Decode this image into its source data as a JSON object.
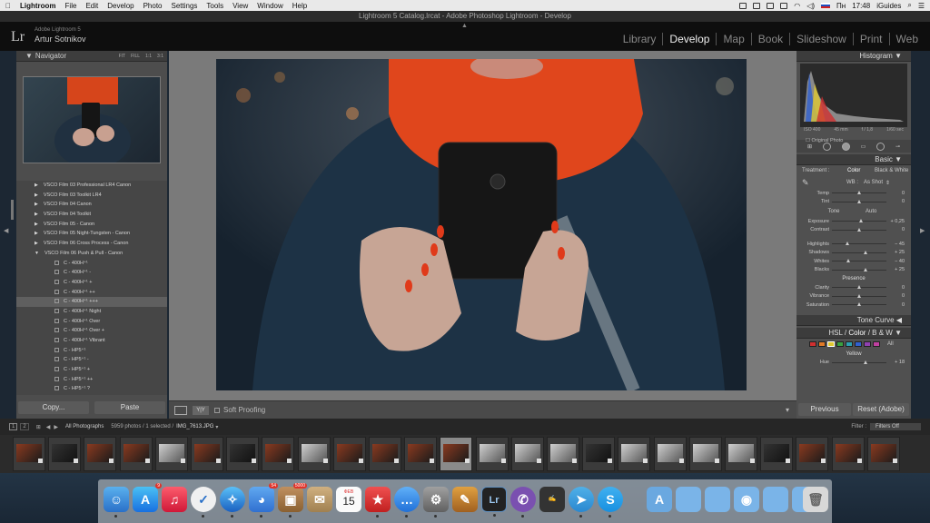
{
  "menubar": {
    "apple": "",
    "app": "Lightroom",
    "items": [
      "File",
      "Edit",
      "Develop",
      "Photo",
      "Settings",
      "Tools",
      "View",
      "Window",
      "Help"
    ],
    "lang": "Пн",
    "time": "17:48",
    "user": "iGuides",
    "battery": "",
    "wifi": ""
  },
  "window": {
    "title": "Lightroom 5 Catalog.lrcat - Adobe Photoshop Lightroom - Develop"
  },
  "identity": {
    "logo": "Lr",
    "version": "Adobe Lightroom 5",
    "user": "Artur Sotnikov"
  },
  "modules": [
    {
      "label": "Library"
    },
    {
      "label": "Develop"
    },
    {
      "label": "Map"
    },
    {
      "label": "Book"
    },
    {
      "label": "Slideshow"
    },
    {
      "label": "Print"
    },
    {
      "label": "Web"
    }
  ],
  "navigator": {
    "title": "Navigator",
    "modes": [
      "FIT",
      "FILL",
      "1:1",
      "3:1"
    ]
  },
  "presets": {
    "folders": [
      "VSCO Film 03 Professional LR4 Canon",
      "VSCO Film 03 Toolkit LR4",
      "VSCO Film 04 Canon",
      "VSCO Film 04 Toolkit",
      "VSCO Film 05 - Canon",
      "VSCO Film 05 Night-Tungsten - Canon",
      "VSCO Film 06 Cross Process - Canon",
      "VSCO Film 06 Push & Pull - Canon"
    ],
    "items": [
      "C - 400H⁺¹",
      "C - 400H⁺¹ -",
      "C - 400H⁺¹ +",
      "C - 400H⁺¹ ++",
      "C - 400H⁺¹ +++",
      "C - 400H⁺¹ Night",
      "C - 400H⁺¹ Over",
      "C - 400H⁺¹ Over +",
      "C - 400H⁺¹ Vibrant",
      "C - HP5⁺¹",
      "C - HP5⁺¹ -",
      "C - HP5⁺¹ +",
      "C - HP5⁺¹ ++",
      "C - HP5⁺¹ ?"
    ],
    "selected_index": 4
  },
  "left_buttons": {
    "copy": "Copy...",
    "paste": "Paste"
  },
  "toolbar": {
    "soft_proofing": "Soft Proofing"
  },
  "histogram": {
    "title": "Histogram",
    "iso": "ISO 400",
    "focal": "45 mm",
    "aperture": "f / 1,8",
    "shutter": "1/60 sec",
    "original_photo": "Original Photo"
  },
  "basic": {
    "title": "Basic",
    "treatment_label": "Treatment :",
    "color": "Color",
    "bw": "Black & White",
    "wb_label": "WB :",
    "wb_value": "As Shot",
    "sliders": [
      {
        "label": "Temp",
        "value": "0",
        "pos": 0.5
      },
      {
        "label": "Tint",
        "value": "0",
        "pos": 0.5
      }
    ],
    "tone_label": "Tone",
    "auto": "Auto",
    "tone": [
      {
        "label": "Exposure",
        "value": "+ 0,25",
        "pos": 0.54
      },
      {
        "label": "Contrast",
        "value": "0",
        "pos": 0.5
      }
    ],
    "tone2": [
      {
        "label": "Highlights",
        "value": "− 45",
        "pos": 0.28
      },
      {
        "label": "Shadows",
        "value": "+ 25",
        "pos": 0.62
      },
      {
        "label": "Whites",
        "value": "− 40",
        "pos": 0.3
      },
      {
        "label": "Blacks",
        "value": "+ 25",
        "pos": 0.62
      }
    ],
    "presence_label": "Presence",
    "presence": [
      {
        "label": "Clarity",
        "value": "0",
        "pos": 0.5
      },
      {
        "label": "Vibrance",
        "value": "0",
        "pos": 0.5
      },
      {
        "label": "Saturation",
        "value": "0",
        "pos": 0.5
      }
    ]
  },
  "tone_curve": {
    "title": "Tone Curve"
  },
  "hsl": {
    "hsl": "HSL",
    "slash1": "/",
    "color": "Color",
    "slash2": "/",
    "bw": "B & W",
    "all": "All",
    "yellow": "Yellow",
    "hue_label": "Hue",
    "hue_value": "+ 18",
    "hue_pos": 0.62,
    "swatches": [
      "#d03030",
      "#e07a28",
      "#e0c830",
      "#3aa040",
      "#2ca0b0",
      "#3060d0",
      "#9040b0",
      "#c040a0"
    ]
  },
  "right_buttons": {
    "previous": "Previous",
    "reset": "Reset (Adobe)"
  },
  "filterbar": {
    "pages": [
      "1",
      "2"
    ],
    "source": "All Photographs",
    "count": "5959 photos / 1 selected /",
    "filename": "IMG_7613.JPG",
    "filter_label": "Filter :",
    "filter_value": "Filters Off"
  },
  "filmstrip": {
    "selected_index": 12,
    "count": 25
  },
  "dock": {
    "badges": {
      "appstore": "9",
      "tweetbot": "54",
      "deliveries": "5000"
    },
    "calendar_month": "ФЕВ",
    "calendar_day": "15"
  }
}
